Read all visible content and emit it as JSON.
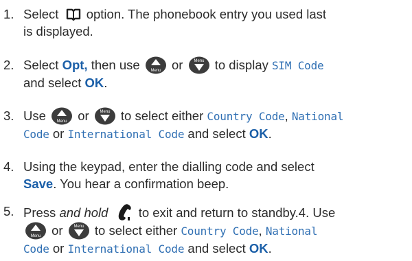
{
  "step1": {
    "num": "1.",
    "a": "Select",
    "icon": "phonebook-icon",
    "b": "option. The phonebook entry you used last",
    "c": "is displayed."
  },
  "step2": {
    "num": "2.",
    "a": "Select",
    "opt": "Opt,",
    "b": "then use",
    "or": "or",
    "c": "to display",
    "sim": "SIM Code",
    "d": "and select",
    "ok": "OK",
    "e": "."
  },
  "step3": {
    "num": "3.",
    "a": "Use",
    "or": "or",
    "b": "to select either",
    "country": "Country Code",
    "comma": ",",
    "national1": "National",
    "national2": "Code",
    "or2": "or",
    "international": "International Code",
    "c": "and select",
    "ok": "OK",
    "e": "."
  },
  "step4": {
    "num": "4.",
    "a": "Using the keypad, enter the dialling code and select",
    "save": "Save",
    "b": ". You hear a confirmation beep."
  },
  "step5": {
    "num": "5.",
    "a": "Press",
    "hold": "and hold",
    "b": "to exit and return to standby.4. Use",
    "or": "or",
    "c": "to select either",
    "country": "Country Code",
    "comma": ",",
    "national1": "National",
    "national2": "Code",
    "or2": "or",
    "international": "International Code",
    "d": "and select",
    "ok": "OK",
    "e": "."
  },
  "icons": {
    "up_button": "up-menu-button-icon",
    "down_button": "down-menu-button-icon",
    "up_label": "Menu",
    "down_label": "Menu",
    "end_call": "end-call-icon"
  }
}
